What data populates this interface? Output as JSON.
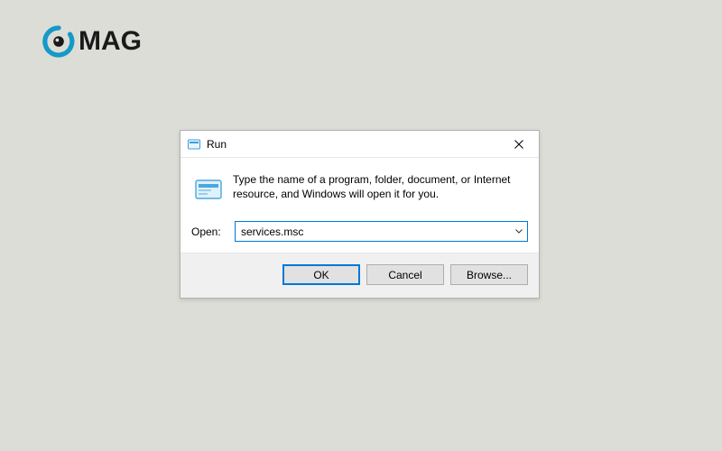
{
  "logo": {
    "text": "MAG"
  },
  "dialog": {
    "title": "Run",
    "instruction": "Type the name of a program, folder, document, or Internet resource, and Windows will open it for you.",
    "open_label": "Open:",
    "open_value": "services.msc",
    "buttons": {
      "ok": "OK",
      "cancel": "Cancel",
      "browse": "Browse..."
    }
  }
}
